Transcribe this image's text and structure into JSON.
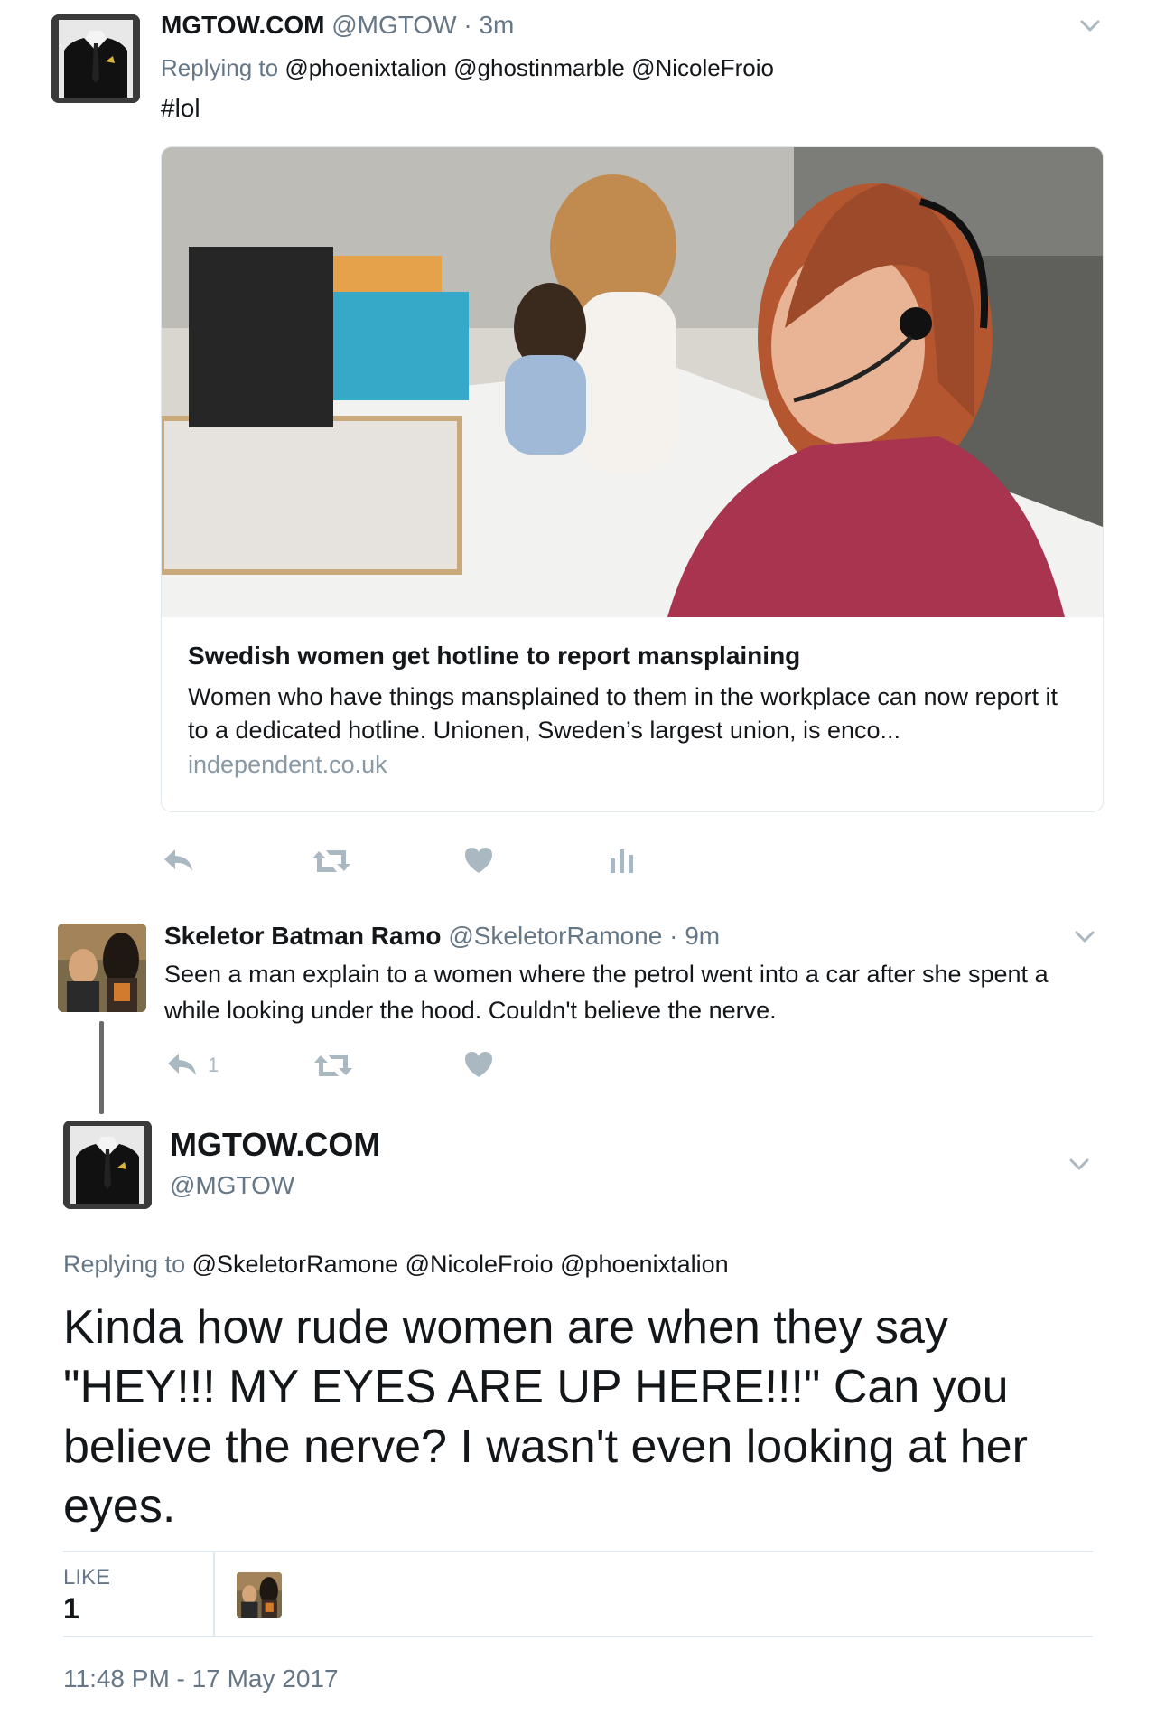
{
  "tweet1": {
    "name": "MGTOW.COM",
    "handle": "@MGTOW",
    "time": "· 3m",
    "replying_label": "Replying to",
    "replying_to": "@phoenixtalion @ghostinmarble @NicoleFroio",
    "text": "#lol",
    "card": {
      "title": "Swedish women get hotline to report mansplaining",
      "description": "Women who have things mansplained to them in the workplace can now report it to a dedicated hotline. Unionen, Sweden’s largest union, is enco...",
      "domain": "independent.co.uk"
    },
    "actions": [
      "reply-icon",
      "retweet-icon",
      "like-icon",
      "analytics-icon"
    ]
  },
  "tweet2": {
    "name": "Skeletor Batman Ramo",
    "handle": "@SkeletorRamone",
    "time": "· 9m",
    "text": "Seen a man explain to a women where the petrol went into a car after she spent a while looking under the hood. Couldn't believe the nerve.",
    "reply_count": "1",
    "actions": [
      "reply-icon",
      "retweet-icon",
      "like-icon"
    ]
  },
  "tweet3": {
    "name": "MGTOW.COM",
    "handle": "@MGTOW",
    "replying_label": "Replying to",
    "replying_to": "@SkeletorRamone @NicoleFroio @phoenixtalion",
    "text": "Kinda how rude women are when they say \"HEY!!! MY EYES ARE UP HERE!!!\" Can you believe the nerve? I wasn't even looking at her eyes.",
    "like_label": "LIKE",
    "like_count": "1",
    "timestamp": "11:48 PM - 17 May 2017"
  },
  "colors": {
    "text": "#14171a",
    "secondary": "#657786",
    "icon": "#aab8c2",
    "divider": "#e1e8ed",
    "card_photo_shirt": "#a8344f"
  }
}
